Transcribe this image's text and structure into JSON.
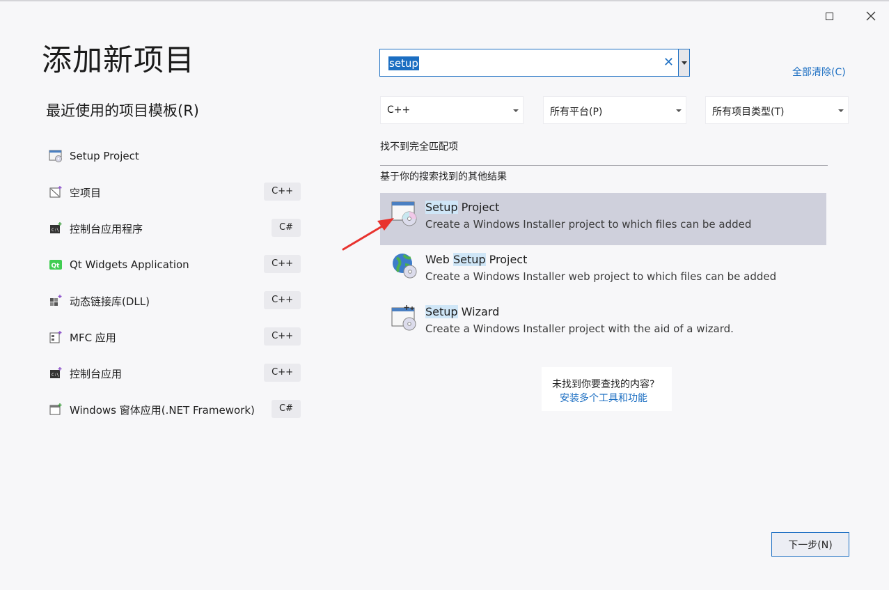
{
  "window": {
    "title": "添加新项目",
    "maximize_icon": "maximize-icon",
    "close_icon": "close-icon"
  },
  "recent": {
    "title": "最近使用的项目模板(R)",
    "items": [
      {
        "label": "Setup Project",
        "lang": "",
        "icon": "setup-project-icon"
      },
      {
        "label": "空项目",
        "lang": "C++",
        "icon": "empty-project-icon"
      },
      {
        "label": "控制台应用程序",
        "lang": "C#",
        "icon": "console-app-icon"
      },
      {
        "label": "Qt Widgets Application",
        "lang": "C++",
        "icon": "qt-icon"
      },
      {
        "label": "动态链接库(DLL)",
        "lang": "C++",
        "icon": "dll-icon"
      },
      {
        "label": "MFC 应用",
        "lang": "C++",
        "icon": "mfc-icon"
      },
      {
        "label": "控制台应用",
        "lang": "C++",
        "icon": "console-icon"
      },
      {
        "label": "Windows 窗体应用(.NET Framework)",
        "lang": "C#",
        "icon": "winforms-icon"
      }
    ]
  },
  "search": {
    "value": "setup",
    "clear_icon": "clear-icon",
    "dropdown_icon": "dropdown-arrow-icon"
  },
  "clear_all": "全部清除(C)",
  "filters": {
    "language": "C++",
    "platform": "所有平台(P)",
    "project_type": "所有项目类型(T)"
  },
  "results": {
    "no_match": "找不到完全匹配项",
    "other_heading": "基于你的搜索找到的其他结果",
    "items": [
      {
        "title_pre": "",
        "title_hl": "Setup",
        "title_post": " Project",
        "desc": "Create a Windows Installer project to which files can be added",
        "selected": true
      },
      {
        "title_pre": "Web ",
        "title_hl": "Setup",
        "title_post": " Project",
        "desc": "Create a Windows Installer web project to which files can be added",
        "selected": false
      },
      {
        "title_pre": "",
        "title_hl": "Setup",
        "title_post": " Wizard",
        "desc": "Create a Windows Installer project with the aid of a wizard.",
        "selected": false
      }
    ]
  },
  "help": {
    "question": "未找到你要查找的内容?",
    "link": "安装多个工具和功能"
  },
  "next_button": "下一步(N)",
  "colors": {
    "accent": "#1b6ec2",
    "selected_row": "#cfd0dc",
    "arrow": "#e8322e"
  }
}
